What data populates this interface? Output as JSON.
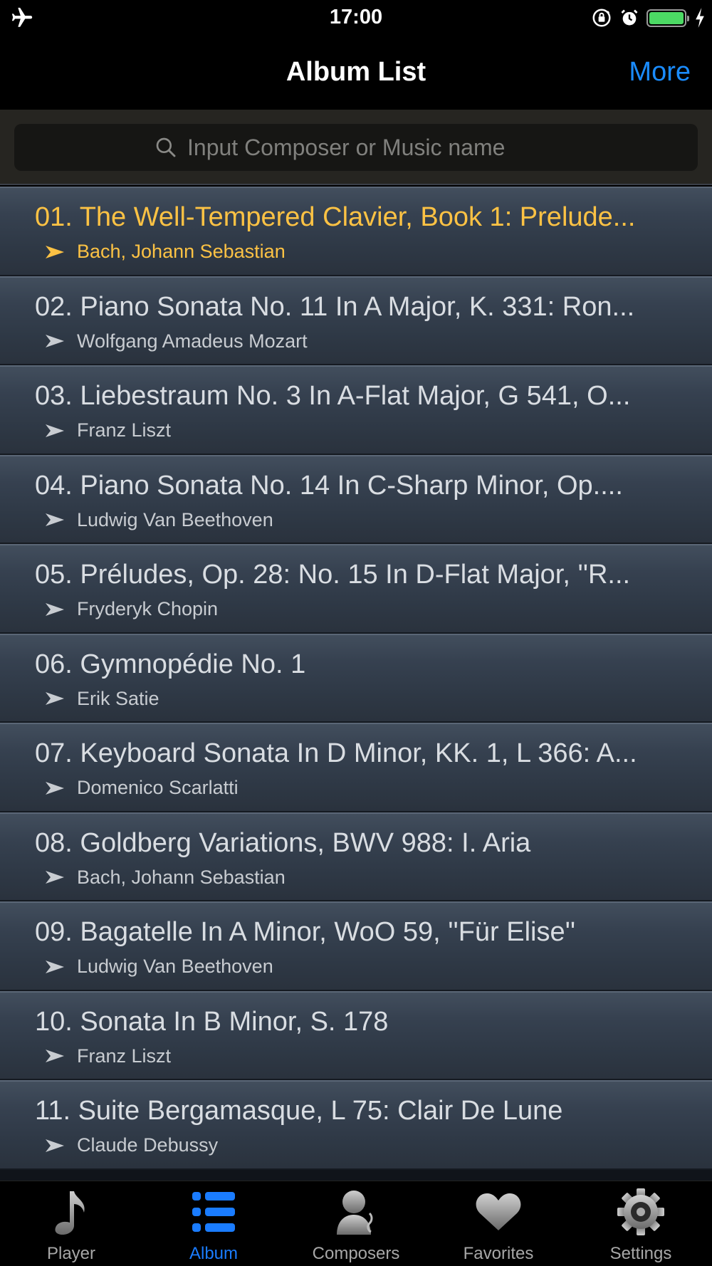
{
  "status_bar": {
    "time": "17:00",
    "battery_level": 1.0
  },
  "nav": {
    "title": "Album List",
    "more_label": "More"
  },
  "search": {
    "placeholder": "Input Composer or Music name",
    "value": ""
  },
  "colors": {
    "accent": "#1a7cff",
    "active_track": "#fcc244",
    "battery": "#4cd964"
  },
  "tracks": [
    {
      "title": "01. The Well-Tempered Clavier, Book 1: Prelude...",
      "artist": "Bach, Johann Sebastian",
      "active": true
    },
    {
      "title": "02. Piano Sonata No. 11 In A Major, K. 331: Ron...",
      "artist": "Wolfgang Amadeus Mozart"
    },
    {
      "title": "03. Liebestraum No. 3 In A-Flat Major, G 541, O...",
      "artist": "Franz Liszt"
    },
    {
      "title": "04. Piano Sonata No. 14 In C-Sharp Minor, Op....",
      "artist": "Ludwig Van Beethoven"
    },
    {
      "title": "05. Préludes, Op. 28: No. 15 In D-Flat Major, ''R...",
      "artist": "Fryderyk Chopin"
    },
    {
      "title": "06. Gymnopédie No. 1",
      "artist": "Erik Satie"
    },
    {
      "title": "07. Keyboard Sonata In D Minor, KK. 1, L 366: A...",
      "artist": "Domenico Scarlatti"
    },
    {
      "title": "08. Goldberg Variations, BWV 988: I. Aria",
      "artist": "Bach, Johann Sebastian"
    },
    {
      "title": "09. Bagatelle In A Minor, WoO 59, ''Für Elise''",
      "artist": "Ludwig Van Beethoven"
    },
    {
      "title": "10. Sonata In B Minor, S. 178",
      "artist": "Franz Liszt"
    },
    {
      "title": "11. Suite Bergamasque, L 75: Clair De Lune",
      "artist": "Claude Debussy"
    }
  ],
  "tabs": [
    {
      "label": "Player",
      "icon": "music-note-icon"
    },
    {
      "label": "Album",
      "icon": "list-icon",
      "selected": true
    },
    {
      "label": "Composers",
      "icon": "composer-bust-icon"
    },
    {
      "label": "Favorites",
      "icon": "heart-icon"
    },
    {
      "label": "Settings",
      "icon": "gear-icon"
    }
  ]
}
